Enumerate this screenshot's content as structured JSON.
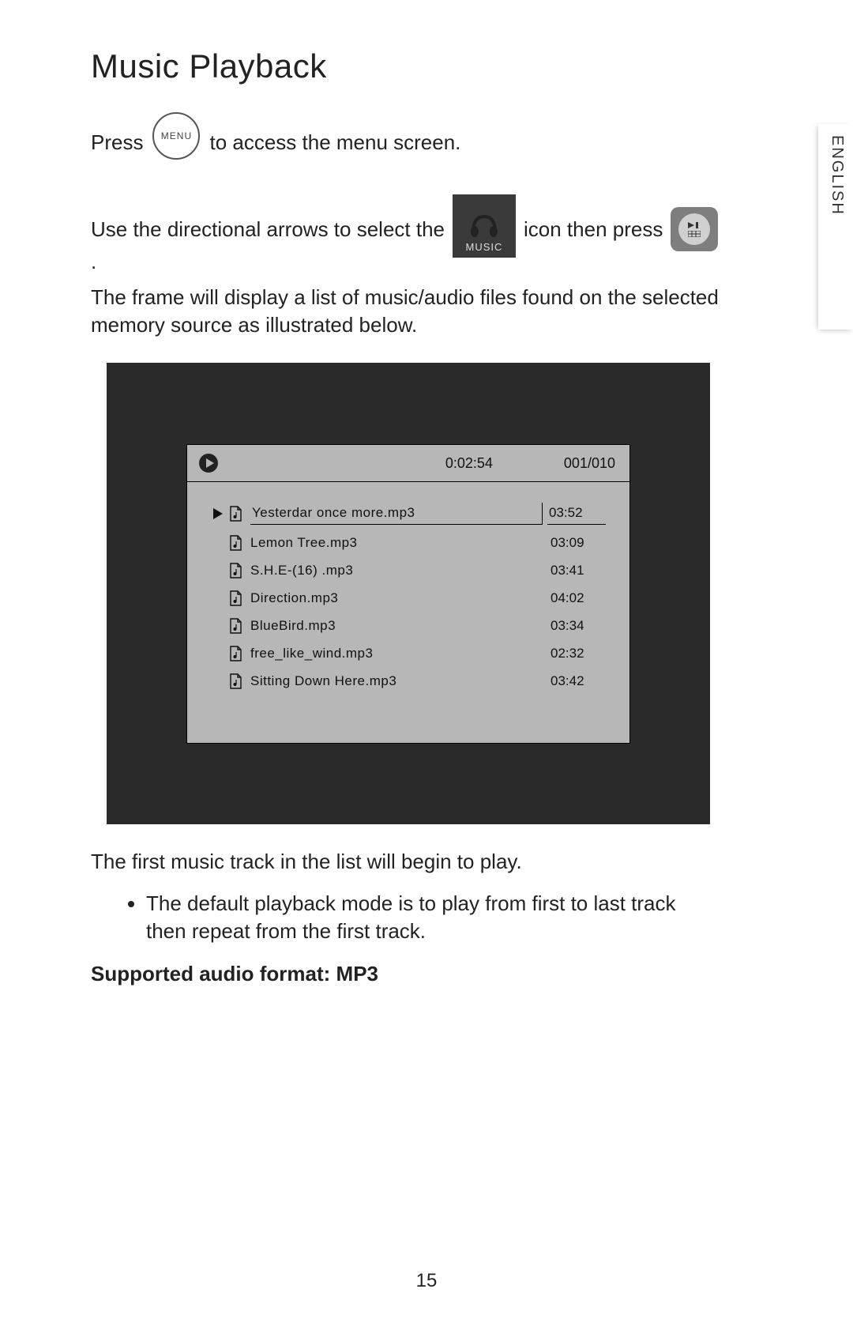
{
  "title": "Music Playback",
  "side_tab": "ENGLISH",
  "instr": {
    "press": "Press",
    "menu_btn": "MENU",
    "to_access": "to access the menu screen.",
    "use_arrows": "Use the directional arrows to select the",
    "music_label": "MUSIC",
    "icon_then_press": "icon then press",
    "period": ".",
    "after_press": "The frame will display a list of music/audio files found on the selected memory source as illustrated below."
  },
  "player": {
    "elapsed": "0:02:54",
    "counter": "001/010",
    "tracks": [
      {
        "name": "Yesterdar once more.mp3",
        "dur": "03:52",
        "current": true
      },
      {
        "name": "Lemon Tree.mp3",
        "dur": "03:09",
        "current": false
      },
      {
        "name": "S.H.E-(16) .mp3",
        "dur": "03:41",
        "current": false
      },
      {
        "name": "Direction.mp3",
        "dur": "04:02",
        "current": false
      },
      {
        "name": "BlueBird.mp3",
        "dur": "03:34",
        "current": false
      },
      {
        "name": "free_like_wind.mp3",
        "dur": "02:32",
        "current": false
      },
      {
        "name": "Sitting Down Here.mp3",
        "dur": "03:42",
        "current": false
      }
    ]
  },
  "post_text": "The first music track in the list will begin to play.",
  "bullet": "The default playback mode is to play from first to last track then repeat from the first track.",
  "supported_label": "Supported audio format:  MP3",
  "page_number": "15"
}
